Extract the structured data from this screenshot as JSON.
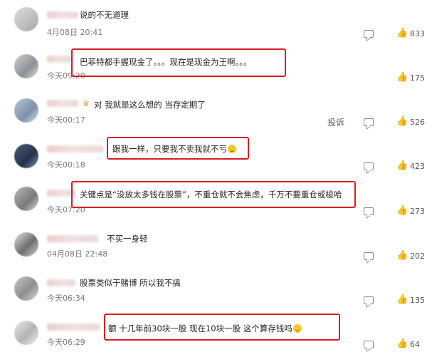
{
  "comments": [
    {
      "comment": "说的不无道理",
      "time": "4月08日 20:41",
      "likes": "833"
    },
    {
      "comment": "巴菲特都手握现金了。。。现在是现金为王啊。。。",
      "time": "今天09:20",
      "likes": "175"
    },
    {
      "comment": "对 我就是这么想的 当存定期了",
      "time": "今天00:17",
      "likes": "526",
      "report": "投诉"
    },
    {
      "comment": "跟我一样，只要我不卖我就不亏",
      "time": "今天00:18",
      "likes": "423"
    },
    {
      "comment": "关键点是“没放太多钱在股票”，不重仓就不会焦虑，千万不要重仓或梭哈",
      "time": "今天07:20",
      "likes": "273"
    },
    {
      "comment": "不买一身轻",
      "time": "04月08日 22:48",
      "likes": "202"
    },
    {
      "comment": "股票类似于赌博 所以我不搞",
      "time": "今天06:34",
      "likes": "135"
    },
    {
      "comment": "额 十几年前30块一股 现在10块一股 这个算存钱吗",
      "time": "今天06:29",
      "likes": "64"
    }
  ],
  "icons": {
    "reply": "comment-icon",
    "like": "thumbs-up-icon",
    "badge": "crown-icon",
    "emoji": "laughing-emoji"
  },
  "colors": {
    "highlight_box": "#d81e24"
  }
}
